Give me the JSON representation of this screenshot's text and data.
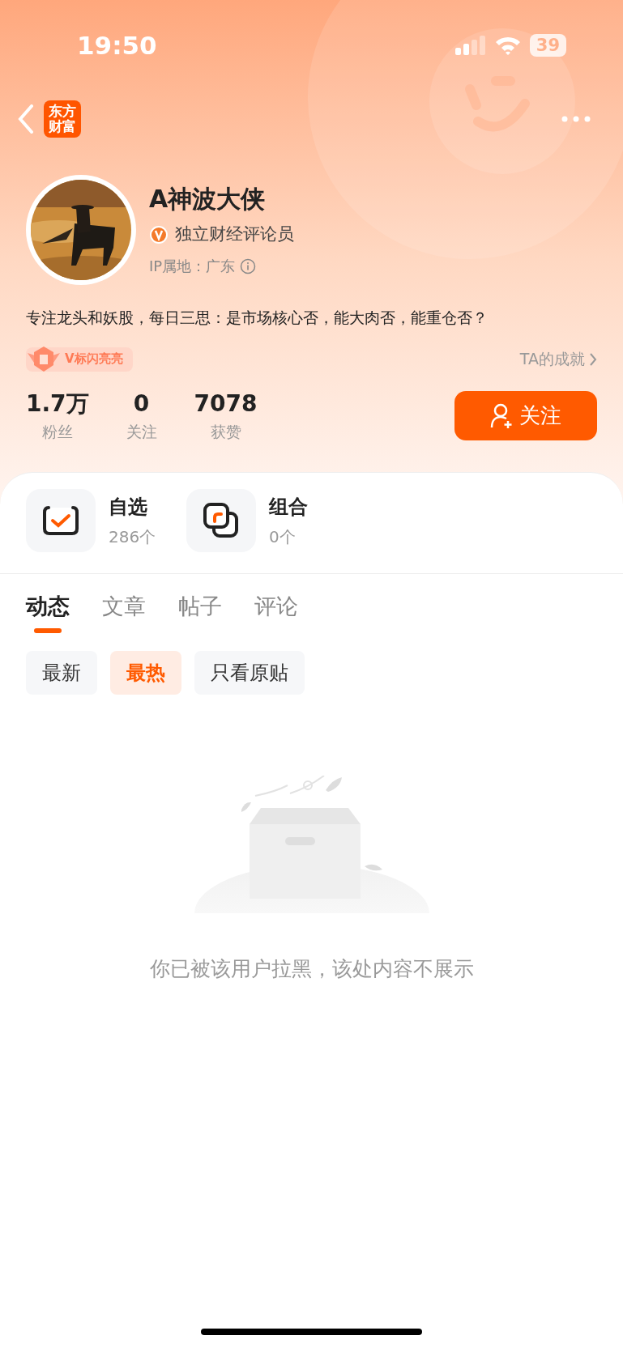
{
  "status_bar": {
    "time": "19:50",
    "battery": "39"
  },
  "header": {
    "app_logo": [
      "东方",
      "财富"
    ]
  },
  "profile": {
    "name": "A神波大侠",
    "verified": true,
    "verified_title": "独立财经评论员",
    "ip_location": "IP属地：广东",
    "bio": "专注龙头和妖股，每日三思：是市场核心否，能大肉否，能重仓否？",
    "badge": "V标闪亮亮",
    "achievements_link": "TA的成就"
  },
  "stats": [
    {
      "value": "1.7万",
      "label": "粉丝"
    },
    {
      "value": "0",
      "label": "关注"
    },
    {
      "value": "7078",
      "label": "获赞"
    }
  ],
  "follow_button": "关注",
  "shortcuts": [
    {
      "kind": "watchlist",
      "title": "自选",
      "count": "286个"
    },
    {
      "kind": "portfolio",
      "title": "组合",
      "count": "0个"
    }
  ],
  "tabs": [
    {
      "label": "动态",
      "selected": true
    },
    {
      "label": "文章",
      "selected": false
    },
    {
      "label": "帖子",
      "selected": false
    },
    {
      "label": "评论",
      "selected": false
    }
  ],
  "filters": [
    {
      "label": "最新",
      "selected": false
    },
    {
      "label": "最热",
      "selected": true
    },
    {
      "label": "只看原贴",
      "selected": false
    }
  ],
  "empty_state": {
    "message": "你已被该用户拉黑，该处内容不展示"
  }
}
